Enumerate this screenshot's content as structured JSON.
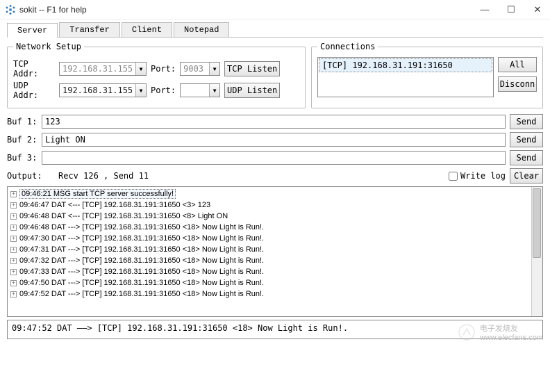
{
  "window": {
    "title": "sokit -- F1 for help",
    "min": "—",
    "max": "☐",
    "close": "✕"
  },
  "tabs": [
    "Server",
    "Transfer",
    "Client",
    "Notepad"
  ],
  "active_tab": 0,
  "network_setup": {
    "legend": "Network Setup",
    "tcp_label": "TCP Addr:",
    "tcp_addr": "192.168.31.155",
    "tcp_port_label": "Port:",
    "tcp_port": "9003",
    "tcp_listen": "TCP Listen",
    "udp_label": "UDP Addr:",
    "udp_addr": "192.168.31.155",
    "udp_port_label": "Port:",
    "udp_port": "",
    "udp_listen": "UDP Listen"
  },
  "connections": {
    "legend": "Connections",
    "items": [
      "[TCP] 192.168.31.191:31650"
    ],
    "all": "All",
    "disconn": "Disconn"
  },
  "buffers": {
    "b1_label": "Buf 1:",
    "b1_value": "123",
    "b2_label": "Buf 2:",
    "b2_value": "Light ON",
    "b3_label": "Buf 3:",
    "b3_value": "",
    "send": "Send"
  },
  "output": {
    "label": "Output:",
    "stats": "Recv 126 ,  Send 11",
    "write_log": "Write log",
    "clear": "Clear"
  },
  "log": [
    "09:46:21 MSG start TCP server successfully!",
    "09:46:47 DAT <--- [TCP] 192.168.31.191:31650 <3> 123",
    "09:46:48 DAT <--- [TCP] 192.168.31.191:31650 <8> Light ON",
    "09:46:48 DAT ---> [TCP] 192.168.31.191:31650 <18>  Now Light is Run!.",
    "09:47:30 DAT ---> [TCP] 192.168.31.191:31650 <18>  Now Light is Run!.",
    "09:47:31 DAT ---> [TCP] 192.168.31.191:31650 <18>  Now Light is Run!.",
    "09:47:32 DAT ---> [TCP] 192.168.31.191:31650 <18>  Now Light is Run!.",
    "09:47:33 DAT ---> [TCP] 192.168.31.191:31650 <18>  Now Light is Run!.",
    "09:47:50 DAT ---> [TCP] 192.168.31.191:31650 <18>  Now Light is Run!.",
    "09:47:52 DAT ---> [TCP] 192.168.31.191:31650 <18>  Now Light is Run!."
  ],
  "status": "09:47:52 DAT ——> [TCP] 192.168.31.191:31650 <18> Now Light is Run!.",
  "watermark": {
    "brand": "电子发烧友",
    "url": "www.elecfans.com"
  }
}
